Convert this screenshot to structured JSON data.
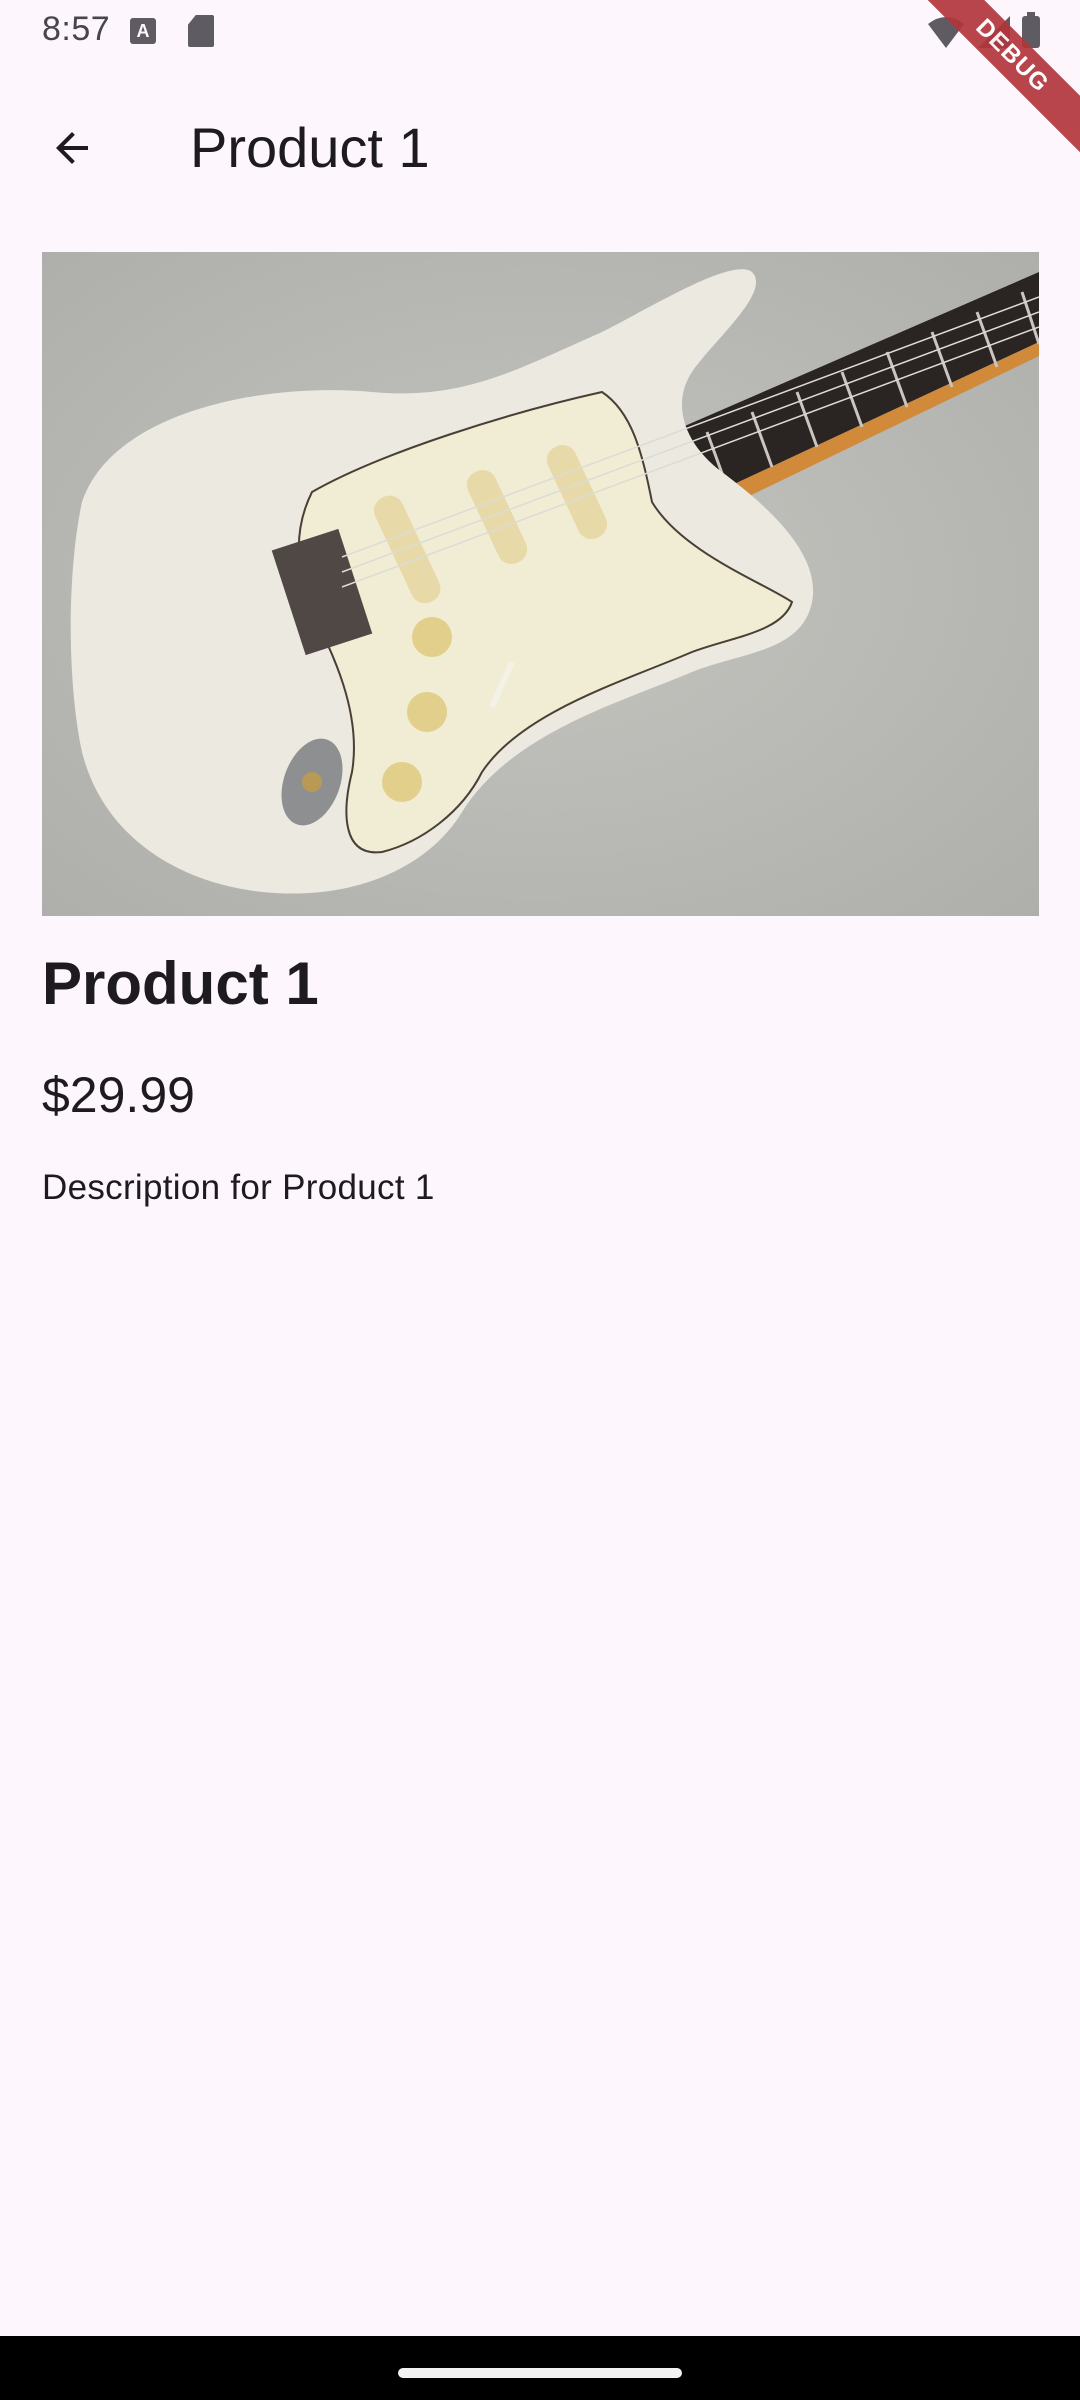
{
  "status_bar": {
    "time": "8:57",
    "left_icons": [
      "text-a-icon",
      "sd-card-icon"
    ],
    "right_icons": [
      "wifi-icon",
      "signal-icon",
      "battery-icon"
    ]
  },
  "debug_banner": "DEBUG",
  "app_bar": {
    "title": "Product 1",
    "back_icon": "arrow-back-icon"
  },
  "product": {
    "image": "electric guitar photo",
    "name": "Product 1",
    "price": "$29.99",
    "description": "Description for Product 1"
  },
  "colors": {
    "background": "#fdf7fd",
    "text": "#1d1b20",
    "debug_ribbon": "#b3363c"
  }
}
